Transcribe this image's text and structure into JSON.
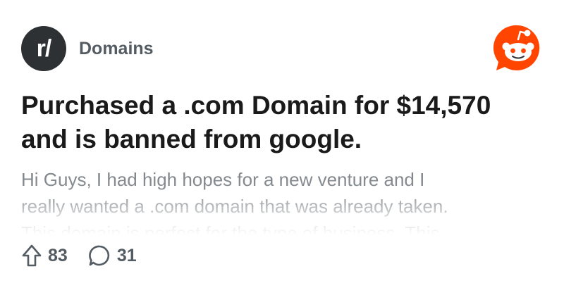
{
  "subreddit": {
    "avatar_text": "r/",
    "name": "Domains"
  },
  "logo": {
    "icon": "reddit-snoo-icon",
    "color": "#ff4500"
  },
  "post": {
    "title": "Purchased a .com Domain for $14,570 and is banned from google.",
    "preview_lines": [
      "Hi Guys, I had high hopes for a new venture and I",
      "really wanted a .com domain that was already taken.",
      "This domain is perfect for the type of business. This"
    ]
  },
  "actions": {
    "upvotes": "83",
    "upvote_icon": "upvote-arrow-icon",
    "comments": "31",
    "comment_icon": "comment-bubble-icon"
  }
}
